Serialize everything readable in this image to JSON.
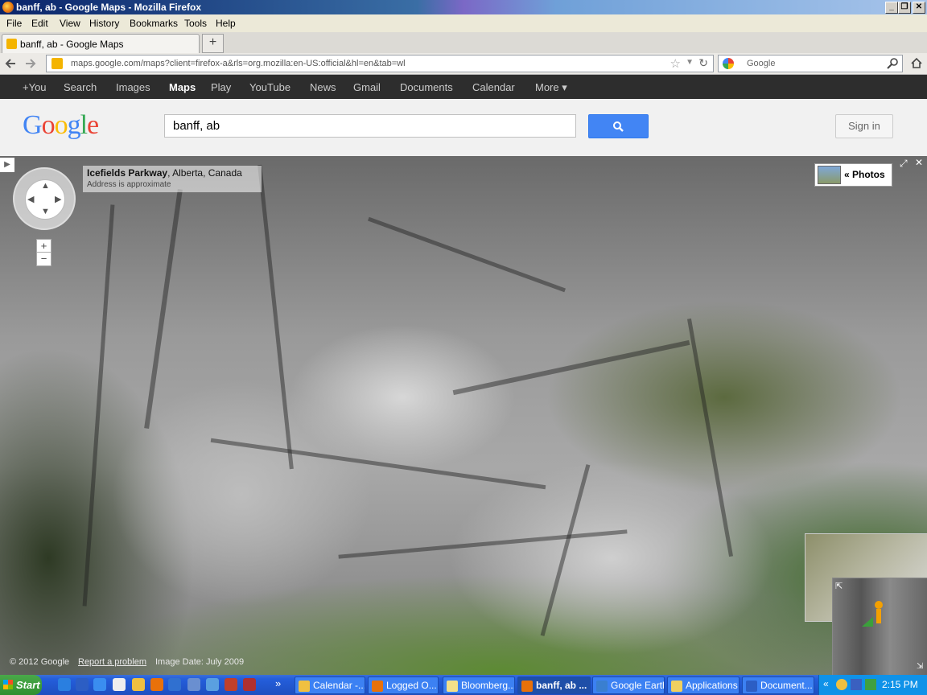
{
  "window": {
    "title": "banff, ab - Google Maps - Mozilla Firefox"
  },
  "menu": [
    "File",
    "Edit",
    "View",
    "History",
    "Bookmarks",
    "Tools",
    "Help"
  ],
  "tab": {
    "title": "banff, ab - Google Maps",
    "new_tab": "+"
  },
  "nav": {
    "url": "maps.google.com/maps?client=firefox-a&rls=org.mozilla:en-US:official&hl=en&tab=wl",
    "search_placeholder": "Google"
  },
  "gbar": {
    "items": [
      "+You",
      "Search",
      "Images",
      "Maps",
      "Play",
      "YouTube",
      "News",
      "Gmail",
      "Documents",
      "Calendar",
      "More ▾"
    ],
    "selected": "Maps"
  },
  "header": {
    "logo": "Google",
    "query": "banff, ab",
    "signin": "Sign in"
  },
  "streetview": {
    "location_bold": "Icefields Parkway",
    "location_rest": ", Alberta, Canada",
    "address_note": "Address is approximate",
    "photos_label": "« Photos",
    "zoom_in": "+",
    "zoom_out": "−",
    "copyright": "© 2012 Google",
    "report": "Report a problem",
    "image_date": "Image Date: July 2009"
  },
  "taskbar": {
    "start": "Start",
    "buttons": [
      "Calendar -...",
      "Logged O...",
      "Bloomberg...",
      "banff, ab ...",
      "Google Earth",
      "Applications",
      "Document..."
    ],
    "active_index": 3,
    "clock": "2:15 PM",
    "expand": "«",
    "ql_more": "»"
  },
  "colors": {
    "accent": "#4285f4",
    "gbar": "#2d2d2d",
    "taskbar": "#245edb"
  }
}
